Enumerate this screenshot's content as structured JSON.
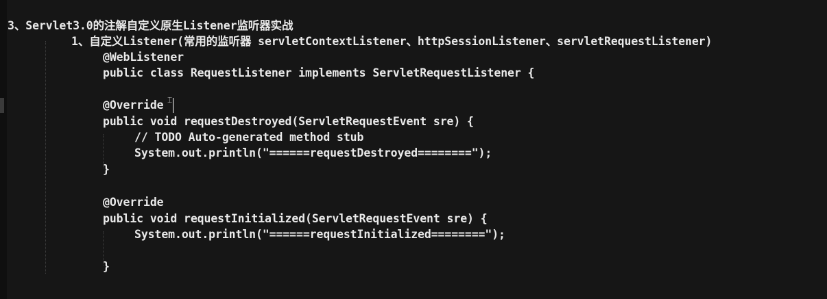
{
  "heading": "3、Servlet3.0的注解自定义原生Listener监听器实战",
  "subheading": "1、自定义Listener(常用的监听器 servletContextListener、httpSessionListener、servletRequestListener)",
  "code_lines": {
    "l1": "@WebListener",
    "l2": "public class RequestListener implements ServletRequestListener {",
    "l3": "@Override",
    "l4": "public void requestDestroyed(ServletRequestEvent sre) {",
    "l5": "// TODO Auto-generated method stub",
    "l6": "System.out.println(\"======requestDestroyed========\");",
    "l7": "}",
    "l8": "@Override",
    "l9": "public void requestInitialized(ServletRequestEvent sre) {",
    "l10": "System.out.println(\"======requestInitialized========\");",
    "l11": "}"
  },
  "colors": {
    "background": "#161616",
    "text": "#e9e9e9",
    "caret": "#ffffff",
    "indent_guide": "#3f3f3f"
  },
  "icons": {
    "text_cursor": "ibeam-cursor-icon"
  }
}
